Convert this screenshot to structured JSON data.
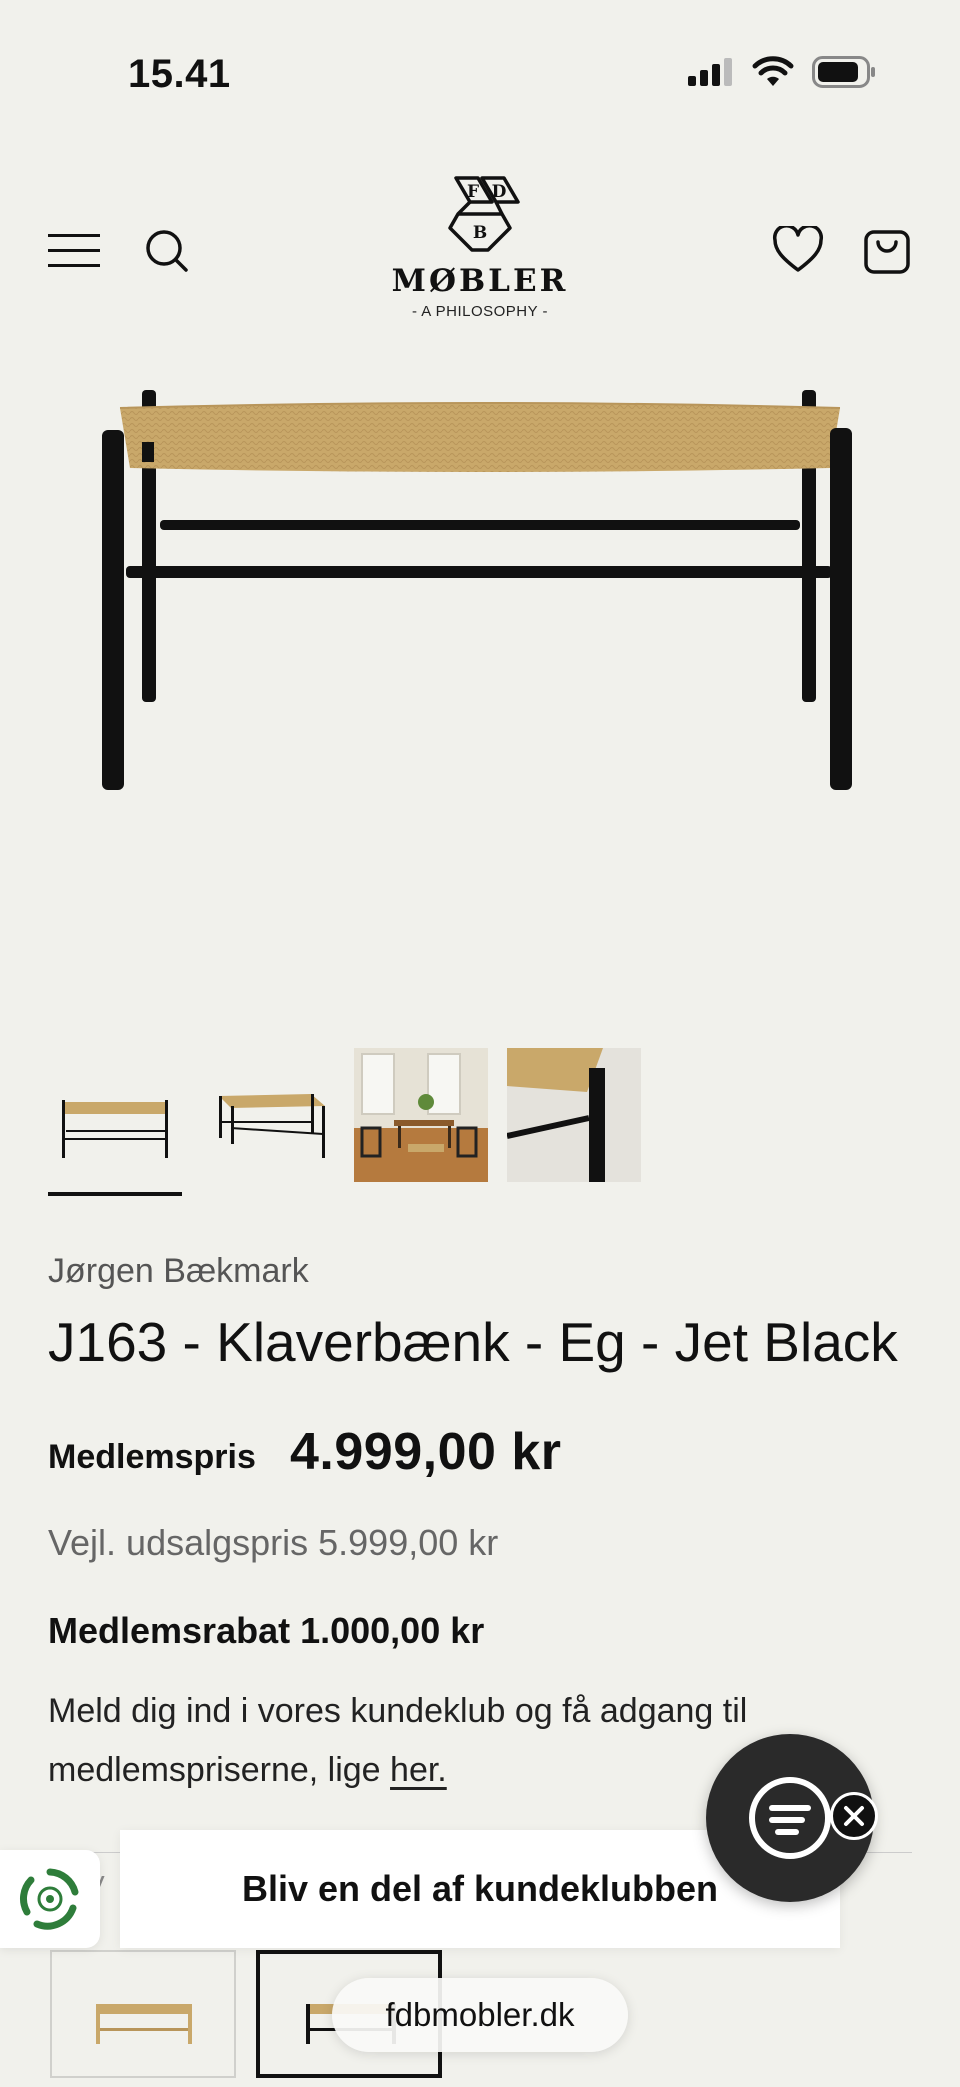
{
  "status_bar": {
    "time": "15.41"
  },
  "header": {
    "logo_word": "MØBLER",
    "logo_sub": "- A PHILOSOPHY -",
    "logo_letters": [
      "F",
      "D",
      "B"
    ]
  },
  "gallery": {
    "thumbnail_count": 4,
    "active_index": 0
  },
  "product": {
    "designer": "Jørgen Bækmark",
    "title": "J163 - Klaverbænk - Eg - Jet Black",
    "member_price_label": "Medlemspris",
    "member_price": "4.999,00 kr",
    "rrp": "Vejl. udsalgspris 5.999,00 kr",
    "member_discount": "Medlemsrabat 1.000,00 kr",
    "club_text": "Meld dig ind i vores kundeklub og få adgang til medlemspriserne, lige ",
    "club_link": "her."
  },
  "partial": {
    "cut_label": "V"
  },
  "overlay": {
    "club_banner": "Bliv en del af kundeklubben",
    "url": "fdbmobler.dk"
  },
  "colors": {
    "background": "#f1f1ec",
    "text": "#111111",
    "muted": "#666666",
    "rope": "#c9a86a",
    "frame": "#111111",
    "recycle_green": "#2e7d3a"
  }
}
